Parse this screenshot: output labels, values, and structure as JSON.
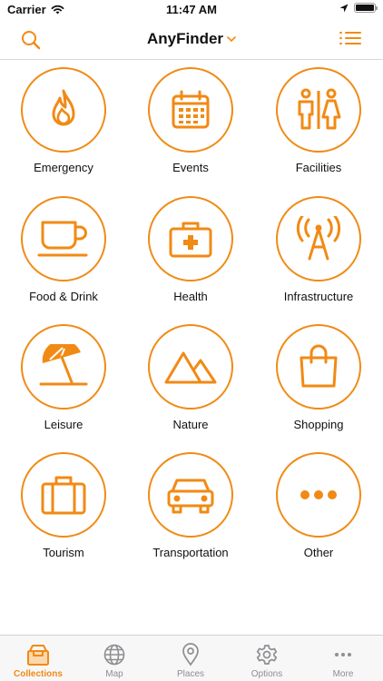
{
  "status_bar": {
    "carrier": "Carrier",
    "time": "11:47 AM"
  },
  "nav": {
    "title": "AnyFinder"
  },
  "categories": [
    {
      "label": "Emergency",
      "icon": "flame-icon"
    },
    {
      "label": "Events",
      "icon": "calendar-icon"
    },
    {
      "label": "Facilities",
      "icon": "restroom-icon"
    },
    {
      "label": "Food & Drink",
      "icon": "coffee-cup-icon"
    },
    {
      "label": "Health",
      "icon": "first-aid-kit-icon"
    },
    {
      "label": "Infrastructure",
      "icon": "radio-tower-icon"
    },
    {
      "label": "Leisure",
      "icon": "beach-umbrella-icon"
    },
    {
      "label": "Nature",
      "icon": "mountains-icon"
    },
    {
      "label": "Shopping",
      "icon": "shopping-bag-icon"
    },
    {
      "label": "Tourism",
      "icon": "suitcase-icon"
    },
    {
      "label": "Transportation",
      "icon": "car-icon"
    },
    {
      "label": "Other",
      "icon": "ellipsis-icon"
    }
  ],
  "tabs": [
    {
      "label": "Collections",
      "icon": "collections-box-icon",
      "active": true
    },
    {
      "label": "Map",
      "icon": "globe-icon",
      "active": false
    },
    {
      "label": "Places",
      "icon": "location-pin-icon",
      "active": false
    },
    {
      "label": "Options",
      "icon": "gear-icon",
      "active": false
    },
    {
      "label": "More",
      "icon": "more-dots-icon",
      "active": false
    }
  ],
  "colors": {
    "accent": "#f18a14",
    "inactive_tab": "#8e8e93",
    "tab_bar_bg": "#f7f7f7"
  }
}
